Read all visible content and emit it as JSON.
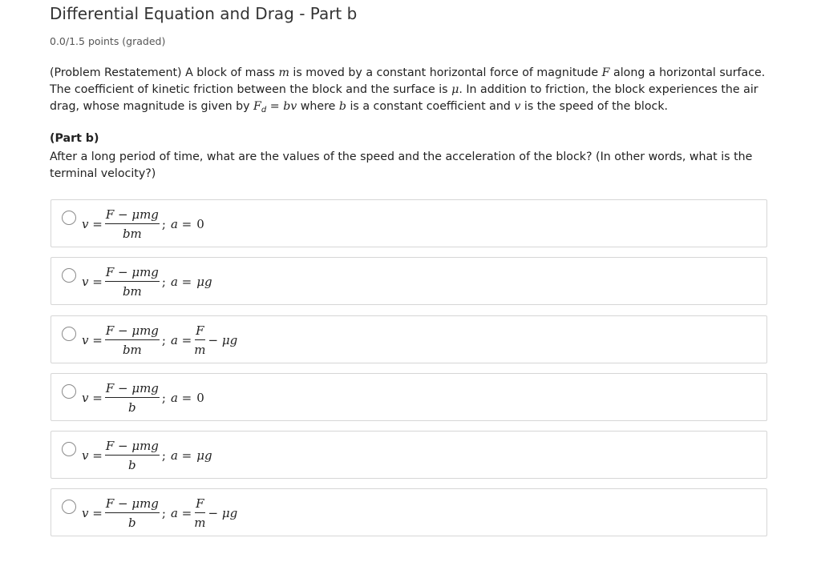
{
  "title": "Differential Equation and Drag - Part b",
  "points": "0.0/1.5 points (graded)",
  "restatement": {
    "t1": "(Problem Restatement) A block of mass ",
    "m": "m",
    "t2": " is moved by a constant horizontal force of magnitude ",
    "F": "F",
    "t3": " along a horizontal surface. The coefficient of kinetic friction between the block and the surface is ",
    "mu": "μ",
    "t4": ". In addition to friction, the block experiences the air drag, whose magnitude is given by ",
    "Fd": "F",
    "d": "d",
    "eqs": " = ",
    "bv": "bv",
    "t5": " where ",
    "b": "b",
    "t6": " is a constant coefficient and ",
    "v": "v",
    "t7": " is the speed of the block."
  },
  "part_b": {
    "label": "(Part b)",
    "question": "After a long period of time, what are the values of the speed and the acceleration of the block? (In other words, what is the terminal velocity?)"
  },
  "math": {
    "v_eq": "v =",
    "numerator": "F − μmg",
    "sep": ";",
    "a_eq": "a =",
    "F": "F",
    "m": "m"
  },
  "options": [
    {
      "den": "bm",
      "a": "0"
    },
    {
      "den": "bm",
      "a": "μg"
    },
    {
      "den": "bm",
      "a_minus": "− μg"
    },
    {
      "den": "b",
      "a": "0"
    },
    {
      "den": "b",
      "a": "μg"
    },
    {
      "den": "b",
      "a_minus": "− μg"
    }
  ]
}
